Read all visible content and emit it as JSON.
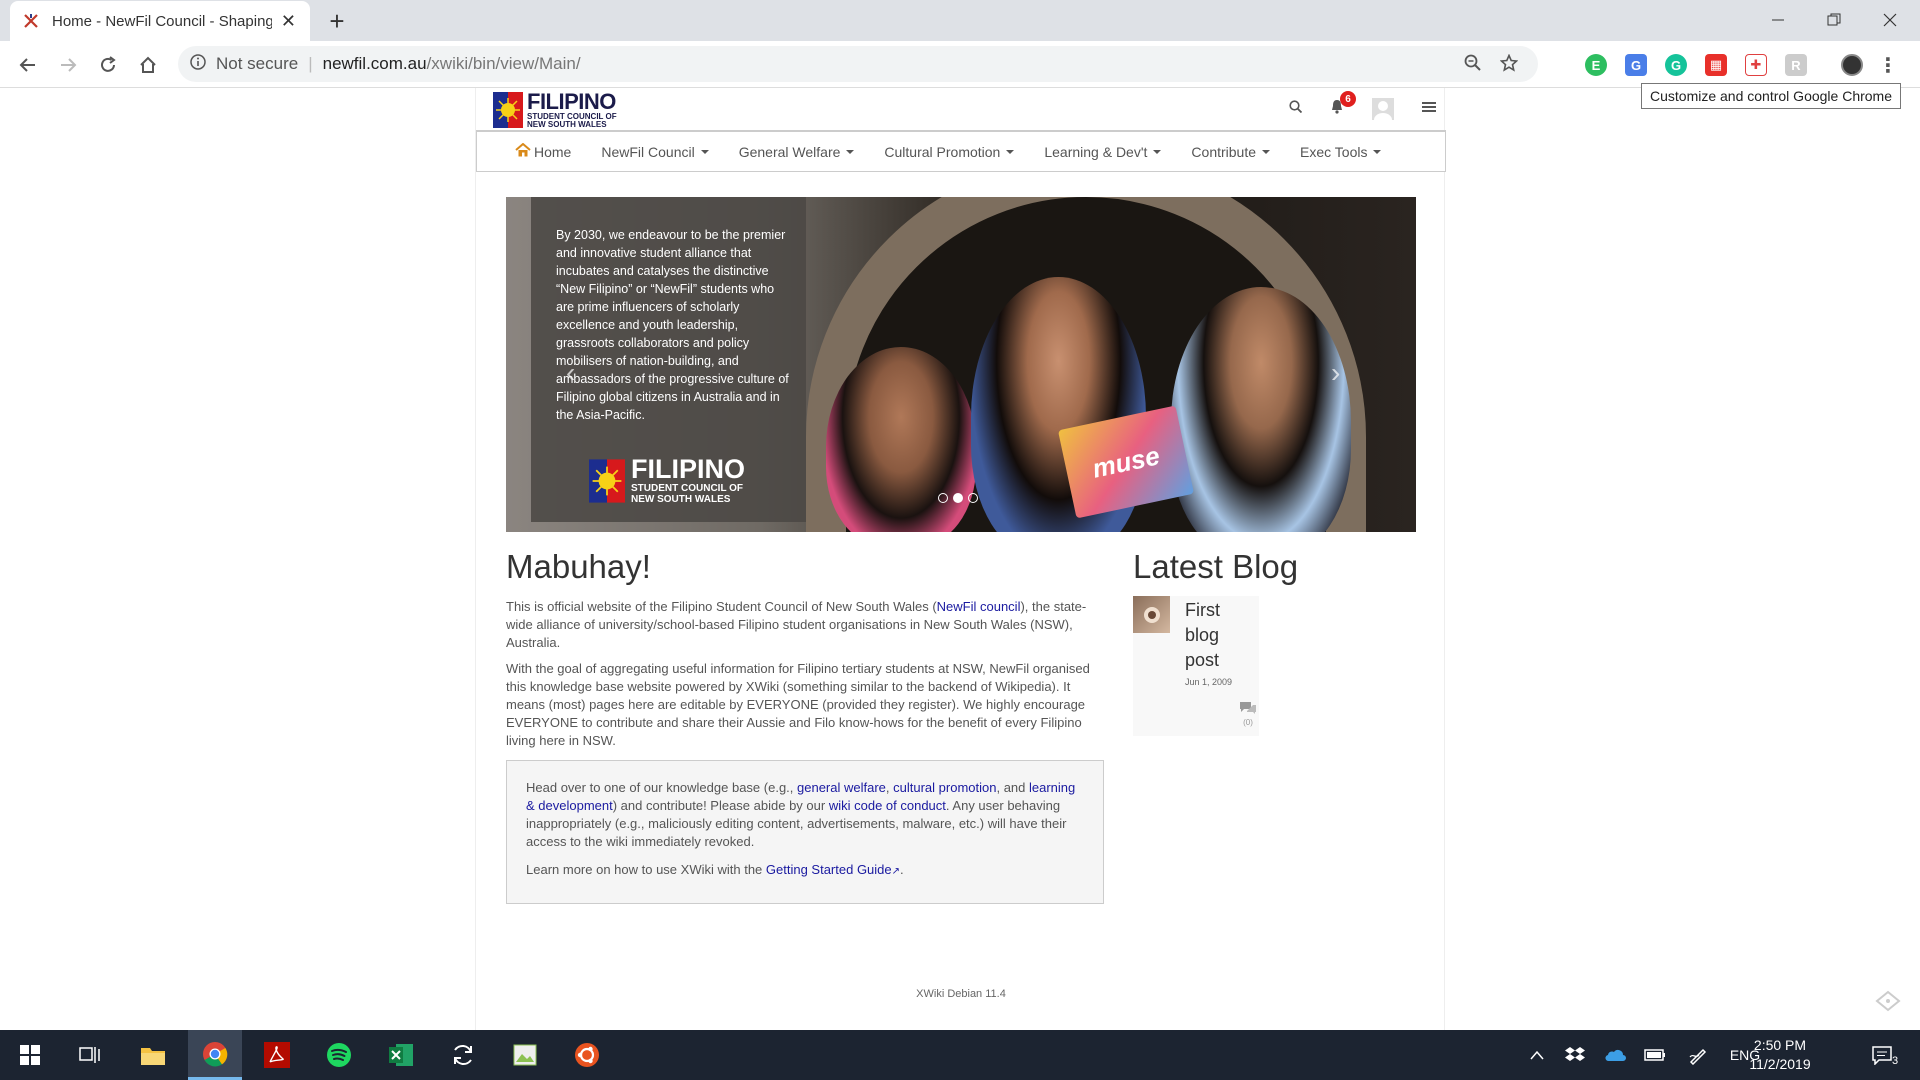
{
  "browser": {
    "tab_title": "Home - NewFil Council - Shaping",
    "new_tab": "+",
    "close_tab": "✕",
    "omnibox": {
      "security": "Not secure",
      "host": "newfil.com.au",
      "path": "/xwiki/bin/view/Main/"
    },
    "tooltip": "Customize and control Google Chrome"
  },
  "site": {
    "logo": {
      "line1": "FILIPINO",
      "line2": "STUDENT COUNCIL OF",
      "line3": "NEW SOUTH WALES"
    },
    "notification_count": "6",
    "menu": [
      {
        "label": "Home",
        "dropdown": false
      },
      {
        "label": "NewFil Council",
        "dropdown": true
      },
      {
        "label": "General Welfare",
        "dropdown": true
      },
      {
        "label": "Cultural Promotion",
        "dropdown": true
      },
      {
        "label": "Learning & Dev't",
        "dropdown": true
      },
      {
        "label": "Contribute",
        "dropdown": true
      },
      {
        "label": "Exec Tools",
        "dropdown": true
      }
    ]
  },
  "carousel": {
    "vision_text": "By 2030, we endeavour to be the premier and innovative student alliance that incubates and catalyses the distinctive “New Filipino” or “NewFil” students who are prime influencers of scholarly excellence and youth leadership, grassroots collaborators and policy mobilisers of nation-building, and ambassadors of the progressive culture of Filipino global citizens in Australia and in the Asia-Pacific.",
    "logo_line1": "FILIPINO",
    "logo_line2": "STUDENT COUNCIL OF",
    "logo_line3": "NEW SOUTH WALES",
    "magazine_text": "muse",
    "slide_count": 3,
    "active_slide": 2
  },
  "main": {
    "heading": "Mabuhay!",
    "p1_before": "This is official website of the Filipino Student Council of New South Wales (",
    "p1_link": "NewFil council",
    "p1_after": "), the state-wide alliance of university/school-based Filipino student organisations in New South Wales (NSW), Australia.",
    "p2": "With the goal of aggregating useful information for Filipino tertiary students at NSW, NewFil organised this knowledge base website powered by XWiki (something similar to the backend of Wikipedia). It means (most) pages here are editable by EVERYONE (provided they register). We highly encourage EVERYONE to contribute and share their Aussie and Filo know-hows for the benefit of every Filipino living here in NSW.",
    "box": {
      "t1": "Head over to one of our knowledge base (e.g., ",
      "link_welfare": "general welfare",
      "t2": ", ",
      "link_cultural": "cultural promotion",
      "t3": ", and ",
      "link_learning": "learning & development",
      "t4": ") and contribute! Please abide by our ",
      "link_conduct": "wiki code of conduct",
      "t5": ". Any user behaving inappropriately (e.g., maliciously editing content, advertisements, malware, etc.) will have their access to the wiki immediately revoked.",
      "t6": "Learn more on how to use XWiki with the ",
      "link_guide": "Getting Started Guide",
      "t7": "."
    }
  },
  "sidebar": {
    "heading": "Latest Blog",
    "post_title": "First blog post",
    "post_date": "Jun 1, 2009",
    "comments": "(0)"
  },
  "footer": {
    "text": "XWiki Debian 11.4"
  },
  "taskbar": {
    "lang": "ENG",
    "time": "2:50 PM",
    "date": "11/2/2019",
    "notifications": "3"
  },
  "colors": {
    "link": "#1a1aa0",
    "badge": "#e0201f",
    "taskbar": "#1c2431"
  }
}
